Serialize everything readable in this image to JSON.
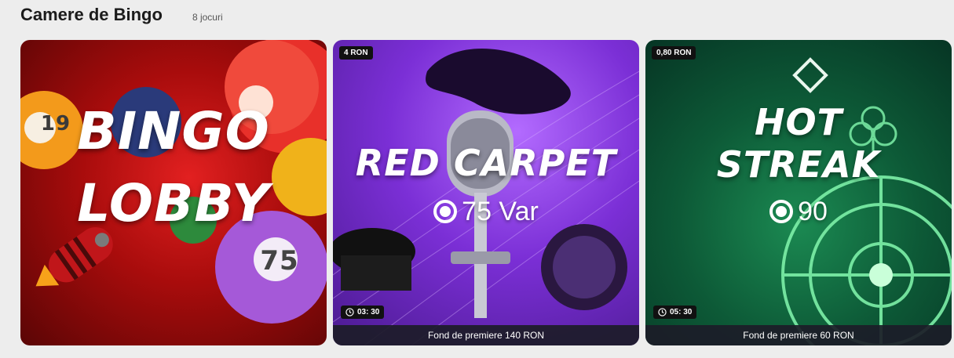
{
  "section": {
    "title": "Camere de Bingo",
    "count": "8 jocuri"
  },
  "cards": [
    {
      "name": "BINGO LOBBY",
      "line1": "BINGO",
      "line2": "LOBBY",
      "balls": [
        "19",
        "75"
      ]
    },
    {
      "name": "RED CARPET",
      "price": "4 RON",
      "subtitle": "75 Var",
      "timer": "03: 30",
      "footer": "Fond de premiere 140 RON"
    },
    {
      "name": "HOT STREAK",
      "line1": "HOT",
      "line2": "STREAK",
      "price": "0,80 RON",
      "subtitle": "90",
      "timer": "05: 30",
      "footer": "Fond de premiere 60 RON"
    }
  ],
  "colors": {
    "bingo_bg": "#c81414",
    "red_carpet_bg": "#7b2fd6",
    "hot_streak_bg": "#0d5a37"
  }
}
